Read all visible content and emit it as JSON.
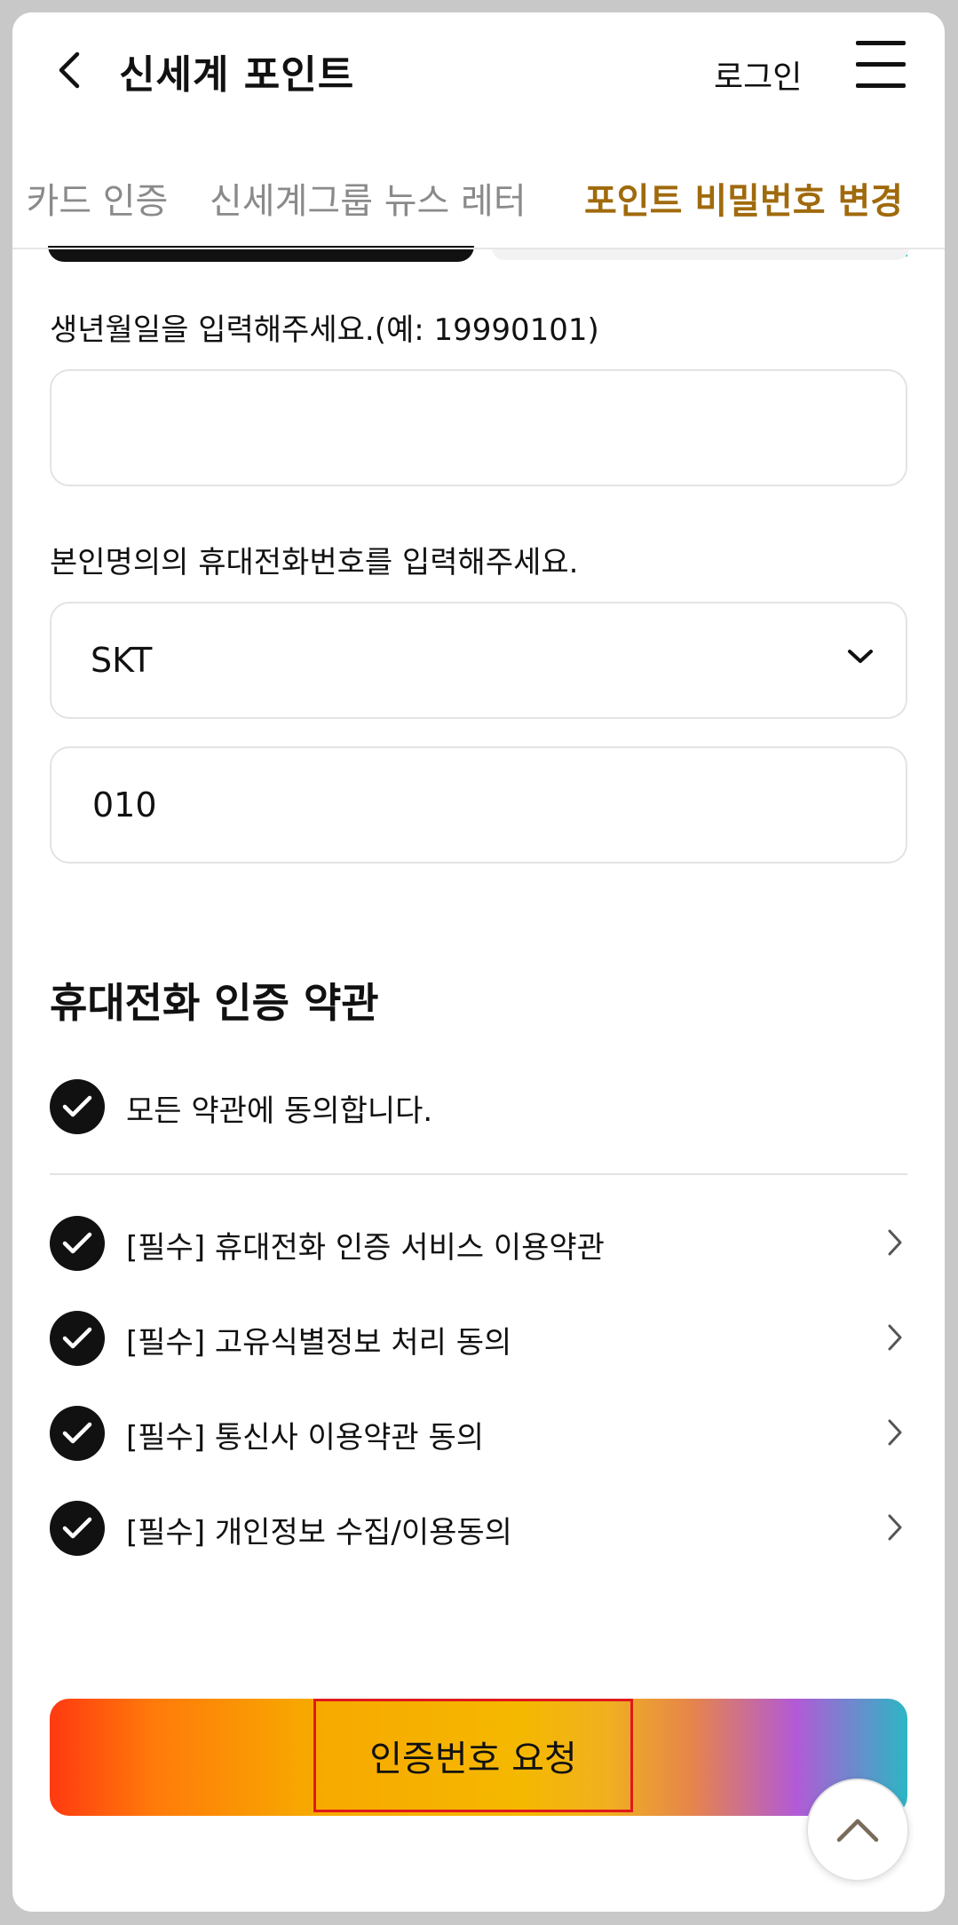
{
  "header": {
    "title": "신세계 포인트",
    "login_label": "로그인"
  },
  "tabs": [
    {
      "label": "카드 인증",
      "active": false
    },
    {
      "label": "신세계그룹 뉴스 레터",
      "active": false
    },
    {
      "label": "포인트 비밀번호 변경",
      "active": true
    }
  ],
  "form": {
    "birth_label": "생년월일을 입력해주세요.(예: 19990101)",
    "birth_value": "",
    "phone_label": "본인명의의 휴대전화번호를 입력해주세요.",
    "carrier_value": "SKT",
    "phone_value": "010"
  },
  "terms": {
    "title": "휴대전화 인증 약관",
    "agree_all": "모든 약관에 동의합니다.",
    "items": [
      {
        "label": "[필수] 휴대전화 인증 서비스 이용약관"
      },
      {
        "label": "[필수] 고유식별정보 처리 동의"
      },
      {
        "label": "[필수] 통신사 이용약관 동의"
      },
      {
        "label": "[필수] 개인정보 수집/이용동의"
      }
    ]
  },
  "cta": {
    "label": "인증번호 요청"
  },
  "icons": {
    "back": "chevron-left-icon",
    "menu": "hamburger-menu-icon",
    "dropdown": "chevron-down-icon",
    "check": "check-icon",
    "row_arrow": "chevron-right-icon",
    "scroll_top": "chevron-up-icon"
  },
  "colors": {
    "active_tab": "#a06a0c",
    "check_bg": "#111111",
    "cta_highlight_border": "#e01a1a"
  }
}
